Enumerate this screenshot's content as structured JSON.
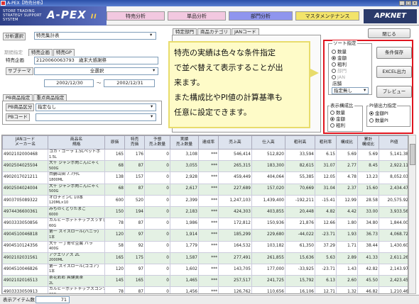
{
  "window": {
    "title": "A-PEX【特売分析】"
  },
  "header": {
    "logo_line1": "STORE TRADING",
    "logo_line2": "STRATEGY SUPPORT",
    "logo_line3": "SYSTEM",
    "logo_name": "A-PEX",
    "logo_suffix": "II",
    "tabs": [
      {
        "label": "特売分析",
        "color": "#f2c8e0"
      },
      {
        "label": "単品分析",
        "color": "#f2c8e0"
      },
      {
        "label": "部門分析",
        "color": "#8f95ee"
      },
      {
        "label": "マスタメンテナンス",
        "color": "#f3e46a"
      }
    ],
    "brand": "APKNET"
  },
  "left": {
    "analysis_label": "分析選択",
    "analysis_value": "特売集計表",
    "period_label": "期間指定",
    "period_tabs": [
      "特売企画",
      "特売GP"
    ],
    "plan_label": "特売企画",
    "plan_value": "2120060063793",
    "plan_name": "歳末大感謝祭",
    "store_label": "サブテーマ",
    "store_value": "全選択",
    "date_from": "2002/12/30",
    "date_sep": "～",
    "date_to": "2002/12/31",
    "pb_tabs": [
      "PB商品指定",
      "重点商品指定"
    ],
    "pb_label": "PB商品区分",
    "pb_value": "指定なし",
    "pbcode_label": "PBコード"
  },
  "middle": {
    "tabs": [
      "特定部門",
      "商品カテゴリ",
      "JANコード"
    ]
  },
  "callout": {
    "lines": [
      "特売の実績は色々な条件指定",
      "で並べ替えて表示することが出",
      "来ます。",
      "また構成比やPI値の計算基準も",
      "任意に設定できます。"
    ]
  },
  "right": {
    "close_label": "閉じる",
    "sort_title": "ソート指定",
    "sort_options": [
      "数量",
      "金額",
      "粗利",
      "部門",
      "JAN"
    ],
    "sort_selected": 1,
    "store_title": "店舗",
    "store_value": "指定無し",
    "ratio_title": "表示構成比",
    "ratio_options": [
      "数量",
      "金額",
      "粗利"
    ],
    "ratio_selected": 1,
    "pi_title": "PI値出力指定",
    "pi_options": [
      "金額PI",
      "数量PI"
    ],
    "pi_selected": 0,
    "buttons": [
      "条件保存",
      "EXCEL出力",
      "プレビュー"
    ]
  },
  "grid": {
    "headers": [
      "JANコード\nメーカー名",
      "商品名\n規格",
      "原価",
      "特売\n売価",
      "予想\n売上数量",
      "実績\n売上数量",
      "達成率",
      "売上高",
      "仕入高",
      "粗利高",
      "粗利率",
      "構成比",
      "累計\n構成比",
      "PI値"
    ],
    "rows": [
      [
        "4902102000468",
        "コカ・コーラ 1.5Lペットボ",
        "1.5L",
        "165",
        "176",
        "0",
        "3,108",
        "***",
        "546,414",
        "512,820",
        "33,594",
        "6.15",
        "5.69",
        "5.69",
        "5,141.38"
      ],
      [
        "4902504025504",
        "大千 ジャンボ肉こんにゃく",
        "500G",
        "68",
        "87",
        "0",
        "3,055",
        "***",
        "265,315",
        "183,300",
        "82,615",
        "31.07",
        "2.77",
        "8.45",
        "2,922.11"
      ],
      [
        "4902017021211",
        "白鶴山田 7.7升L",
        "1800ML",
        "138",
        "157",
        "0",
        "2,928",
        "***",
        "459,449",
        "404,064",
        "55,385",
        "12.05",
        "4.78",
        "13.23",
        "8,052.03"
      ],
      [
        "4902504024004",
        "大千 ジャンボ肉こんにゃく",
        "500G",
        "68",
        "87",
        "0",
        "2,617",
        "***",
        "227,689",
        "157,020",
        "70,669",
        "31.04",
        "2.37",
        "15.60",
        "2,434.47"
      ],
      [
        "4903705089322",
        "オロナミンC 10本",
        "120ML×10",
        "600",
        "520",
        "0",
        "2,399",
        "***",
        "1,247,103",
        "1,439,400",
        "-192,211",
        "-15.41",
        "12.99",
        "28.58",
        "20,575.92"
      ],
      [
        "4974436600361",
        "みちのくどりたまご",
        "6000",
        "150",
        "194",
        "0",
        "2,183",
        "***",
        "424,303",
        "403,855",
        "20,448",
        "4.82",
        "4.42",
        "33.00",
        "3,933.56"
      ],
      [
        "4903333050856",
        "カルビーポテトチップスうすし",
        "60G",
        "78",
        "87",
        "0",
        "1,986",
        "***",
        "172,812",
        "150,936",
        "21,876",
        "12.66",
        "1.80",
        "34.80",
        "1,844.00"
      ],
      [
        "4904510046818",
        "第一 スイスロール(バニラ)",
        "1本",
        "120",
        "97",
        "0",
        "1,914",
        "***",
        "185,299",
        "229,680",
        "-44,022",
        "-23.71",
        "1.93",
        "36.73",
        "4,068.72"
      ],
      [
        "4904510124356",
        "大千 一丁寄せ豆腐 バラ",
        "400G",
        "58",
        "92",
        "0",
        "1,779",
        "***",
        "164,532",
        "103,182",
        "61,350",
        "37.29",
        "1.71",
        "38.44",
        "1,430.60"
      ],
      [
        "4902102031561",
        "アクエリアス 2L",
        "2000ML",
        "165",
        "175",
        "0",
        "1,587",
        "***",
        "277,491",
        "261,855",
        "15,636",
        "5.63",
        "2.89",
        "41.33",
        "2,611.26"
      ],
      [
        "4904510046826",
        "第一 スイスロール(ココア)",
        "1本",
        "120",
        "97",
        "0",
        "1,602",
        "***",
        "143,705",
        "177,000",
        "-33,925",
        "-23.71",
        "1.43",
        "42.82",
        "2,143.97"
      ],
      [
        "4902102016513",
        "茶花彩彩 爽健美茶",
        "2L",
        "145",
        "165",
        "0",
        "1,465",
        "***",
        "257,517",
        "241,725",
        "15,792",
        "6.13",
        "2.60",
        "45.50",
        "2,423.45"
      ],
      [
        "4903333050913",
        "カルビーポテトチップスコンソメ",
        "60G",
        "78",
        "87",
        "0",
        "1,456",
        "***",
        "126,762",
        "110,656",
        "16,106",
        "12.71",
        "1.32",
        "46.82",
        "1,210.46"
      ]
    ]
  },
  "status": {
    "label": "表示アイテム数",
    "value": "71"
  }
}
